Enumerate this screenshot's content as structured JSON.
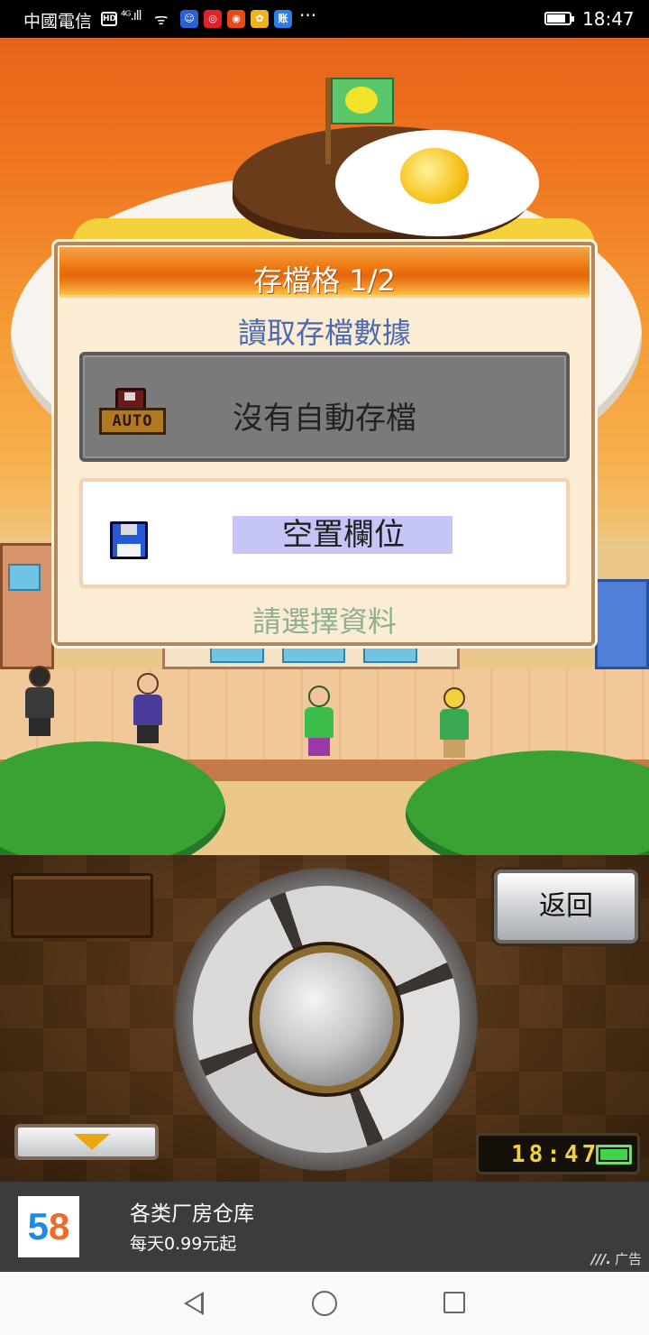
{
  "status_bar": {
    "carrier": "中國電信",
    "hd_badge": "HD",
    "signal": "⁴ᴳ.ıll",
    "apps": [
      {
        "icon": "baidu-app-icon",
        "color": "#2a62d8",
        "glyph": "☺"
      },
      {
        "icon": "netease-music-icon",
        "color": "#e0222a",
        "glyph": "◎"
      },
      {
        "icon": "weibo-icon",
        "color": "#e64a19",
        "glyph": "◉"
      },
      {
        "icon": "fruit-app-icon",
        "color": "#f2b21a",
        "glyph": "✿"
      },
      {
        "icon": "alipay-bill-icon",
        "color": "#2a7ee6",
        "glyph": "账"
      }
    ],
    "more": "···",
    "time": "18:47"
  },
  "dialog": {
    "title": "存檔格 1/2",
    "subtitle": "讀取存檔數據",
    "auto_slot_label": "沒有自動存檔",
    "auto_badge": "AUTO",
    "empty_slot_label": "空置欄位",
    "hint": "請選擇資料"
  },
  "controls": {
    "back_label": "返回",
    "clock_time": "18:47"
  },
  "ad": {
    "logo_text": "58",
    "title": "各类厂房仓库",
    "subtitle": "每天0.99元起",
    "tag": "广告"
  },
  "colors": {
    "dialog_title_bar": "#ee7b14",
    "subtitle": "#4a6ab4",
    "hint": "#8fb08c",
    "highlight": "#c6c6f6"
  }
}
